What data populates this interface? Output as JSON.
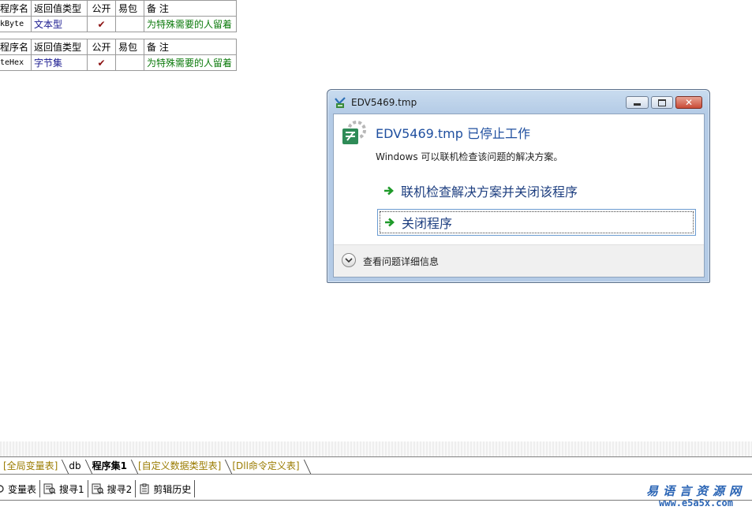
{
  "tables": [
    {
      "headers": [
        "程序名",
        "返回值类型",
        "公开",
        "易包",
        "备 注"
      ],
      "row": {
        "name": "kByte",
        "type": "文本型",
        "public": "✔",
        "package": "",
        "note": "为特殊需要的人留着"
      }
    },
    {
      "headers": [
        "程序名",
        "返回值类型",
        "公开",
        "易包",
        "备 注"
      ],
      "row": {
        "name": "teHex",
        "type": "字节集",
        "public": "✔",
        "package": "",
        "note": "为特殊需要的人留着"
      }
    }
  ],
  "dialog": {
    "title": "EDV5469.tmp",
    "heading": "EDV5469.tmp 已停止工作",
    "description": "Windows 可以联机检查该问题的解决方案。",
    "option_online": "联机检查解决方案并关闭该程序",
    "option_close": "关闭程序",
    "details_label": "查看问题详细信息",
    "close_glyph": "✕"
  },
  "tabs": [
    {
      "label": "[全局变量表]",
      "style": "yellow"
    },
    {
      "label": "db",
      "style": "black"
    },
    {
      "label": "程序集1",
      "style": "active"
    },
    {
      "label": "[自定义数据类型表]",
      "style": "yellow"
    },
    {
      "label": "[Dll命令定义表]",
      "style": "yellow"
    }
  ],
  "toolbar": {
    "vars": "变量表",
    "search1": "搜寻1",
    "search2": "搜寻2",
    "clip": "剪辑历史"
  },
  "watermark": {
    "name": "易语言资源网",
    "url": "www.e5a5x.com"
  },
  "colors": {
    "type_text": "#1a1a8f",
    "note_text": "#0b7a0b",
    "check": "#8b1010",
    "dialog_heading": "#1f4f9f",
    "tab_yellow": "#9a7b00",
    "watermark": "#2b65b5"
  }
}
